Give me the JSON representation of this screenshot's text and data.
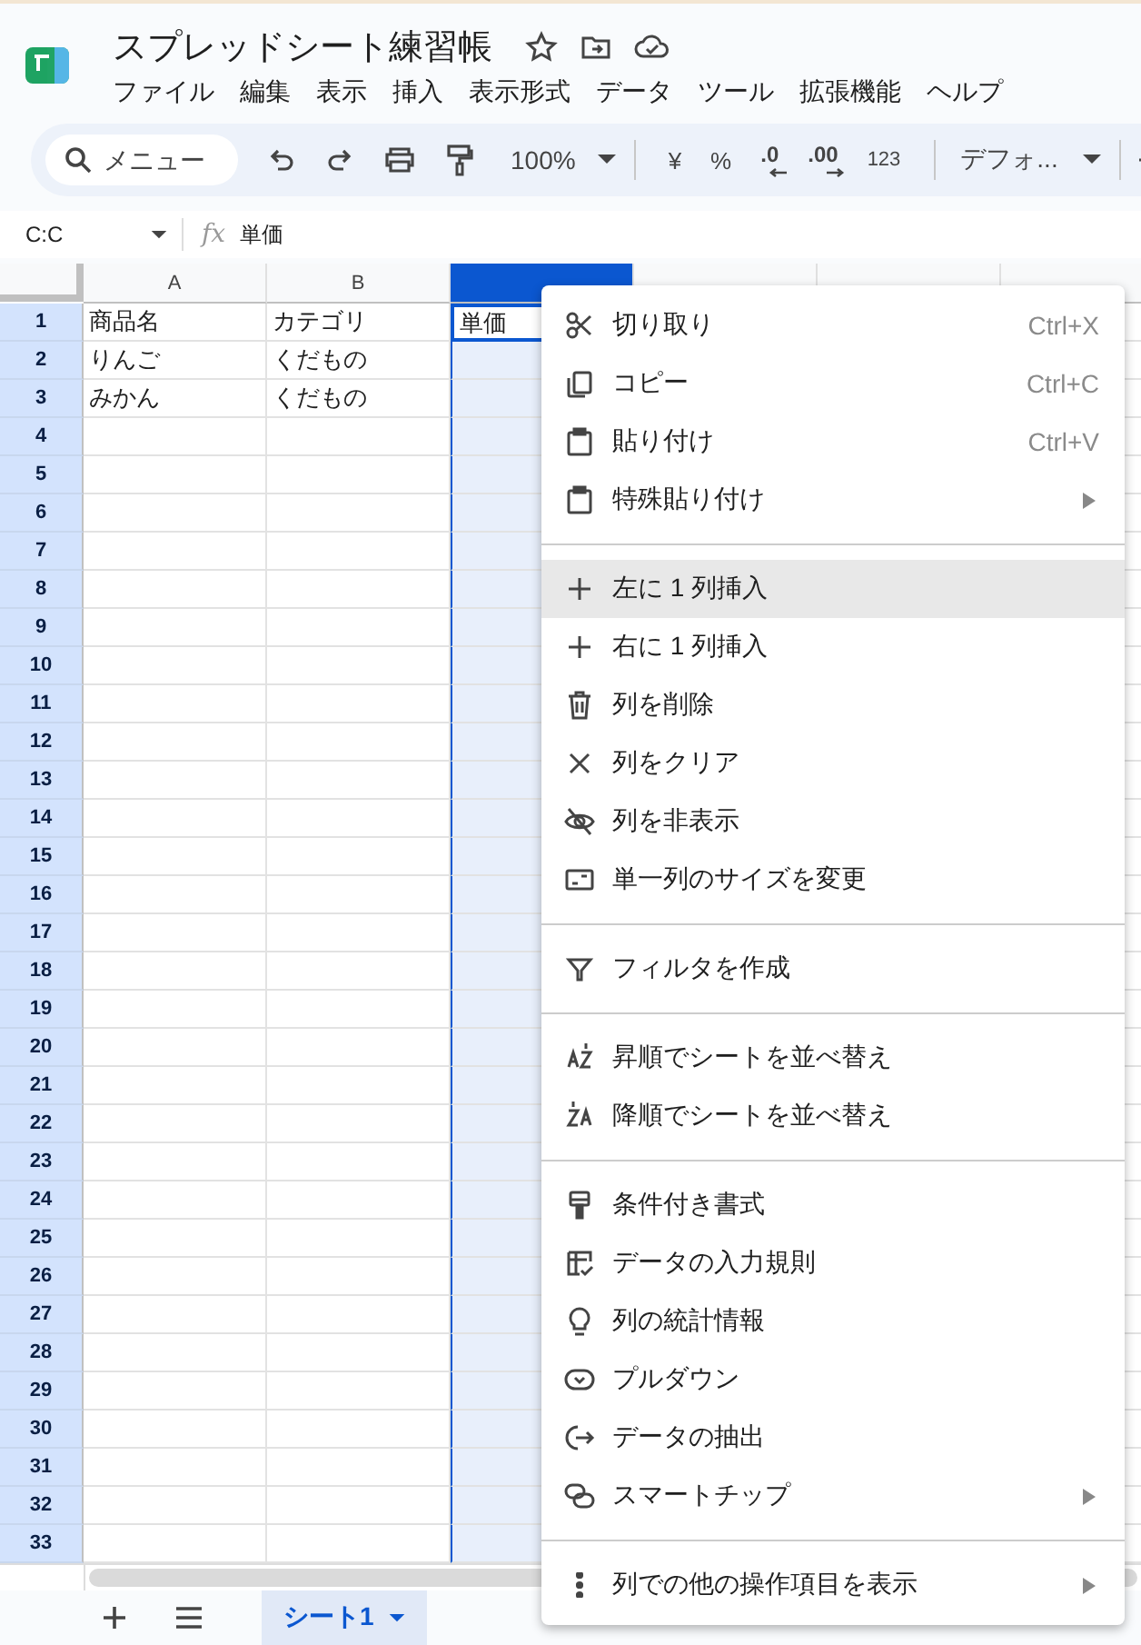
{
  "document": {
    "title": "スプレッドシート練習帳"
  },
  "menu_bar": [
    "ファイル",
    "編集",
    "表示",
    "挿入",
    "表示形式",
    "データ",
    "ツール",
    "拡張機能",
    "ヘルプ"
  ],
  "toolbar": {
    "search_placeholder": "メニュー",
    "zoom": "100%",
    "currency": "¥",
    "percent": "%",
    "decrease_decimals": ".0",
    "increase_decimals": ".00",
    "number_format": "123",
    "font": "デフォ..."
  },
  "formula_bar": {
    "name_box": "C:C",
    "fx": "fx",
    "value": "単価"
  },
  "grid": {
    "columns": [
      {
        "label": "A",
        "selected": false
      },
      {
        "label": "B",
        "selected": false
      },
      {
        "selected": true
      },
      {
        "selected": false
      },
      {
        "selected": false
      },
      {
        "selected": false
      }
    ],
    "rows": [
      {
        "number": "1",
        "cells": [
          "商品名",
          "カテゴリ",
          "単価"
        ]
      },
      {
        "number": "2",
        "cells": [
          "りんご",
          "くだもの"
        ]
      },
      {
        "number": "3",
        "cells": [
          "みかん",
          "くだもの"
        ]
      },
      {
        "number": "4"
      },
      {
        "number": "5"
      },
      {
        "number": "6"
      },
      {
        "number": "7"
      },
      {
        "number": "8"
      },
      {
        "number": "9"
      },
      {
        "number": "10"
      },
      {
        "number": "11"
      },
      {
        "number": "12"
      },
      {
        "number": "13"
      },
      {
        "number": "14"
      },
      {
        "number": "15"
      },
      {
        "number": "16"
      },
      {
        "number": "17"
      },
      {
        "number": "18"
      },
      {
        "number": "19"
      },
      {
        "number": "20"
      },
      {
        "number": "21"
      },
      {
        "number": "22"
      },
      {
        "number": "23"
      },
      {
        "number": "24"
      },
      {
        "number": "25"
      },
      {
        "number": "26"
      },
      {
        "number": "27"
      },
      {
        "number": "28"
      },
      {
        "number": "29"
      },
      {
        "number": "30"
      },
      {
        "number": "31"
      },
      {
        "number": "32"
      },
      {
        "number": "33"
      }
    ]
  },
  "context_menu": {
    "sections": [
      [
        {
          "label": "切り取り",
          "shortcut": "Ctrl+X",
          "selected": false
        },
        {
          "label": "コピー",
          "shortcut": "Ctrl+C",
          "selected": false
        },
        {
          "label": "貼り付け",
          "shortcut": "Ctrl+V",
          "selected": false
        },
        {
          "label": "特殊貼り付け",
          "submenu": true,
          "selected": false
        }
      ],
      [
        {
          "label": "左に 1 列挿入",
          "selected": true
        },
        {
          "label": "右に 1 列挿入",
          "selected": false
        },
        {
          "label": "列を削除",
          "selected": false
        },
        {
          "label": "列をクリア",
          "selected": false
        },
        {
          "label": "列を非表示",
          "selected": false
        },
        {
          "label": "単一列のサイズを変更",
          "selected": false
        }
      ],
      [
        {
          "label": "フィルタを作成",
          "selected": false
        }
      ],
      [
        {
          "label": "昇順でシートを並べ替え",
          "selected": false
        },
        {
          "label": "降順でシートを並べ替え",
          "selected": false
        }
      ],
      [
        {
          "label": "条件付き書式",
          "selected": false
        },
        {
          "label": "データの入力規則",
          "selected": false
        },
        {
          "label": "列の統計情報",
          "selected": false
        },
        {
          "label": "プルダウン",
          "selected": false
        },
        {
          "label": "データの抽出",
          "selected": false
        },
        {
          "label": "スマートチップ",
          "submenu": true,
          "selected": false
        }
      ],
      [
        {
          "label": "列での他の操作項目を表示",
          "submenu": true,
          "selected": false
        }
      ]
    ]
  },
  "sheet_tabs": [
    {
      "label": "シート1",
      "selected": true
    }
  ]
}
